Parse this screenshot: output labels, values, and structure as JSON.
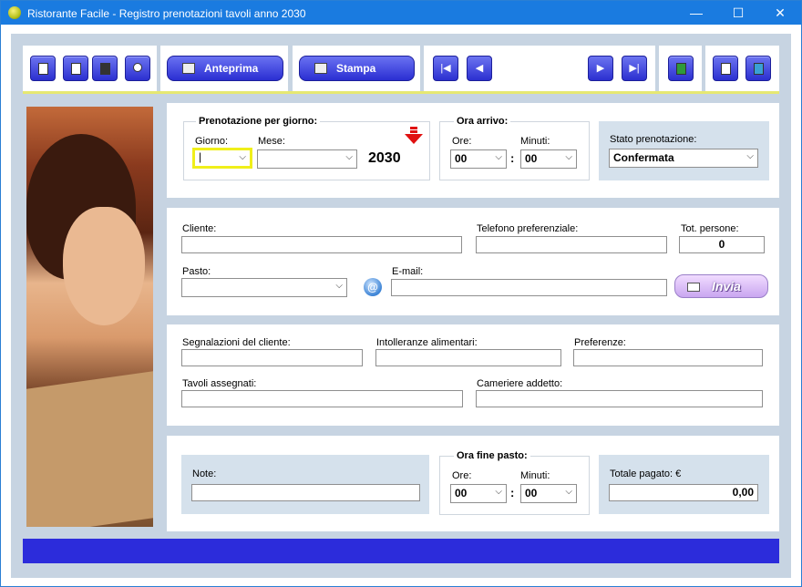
{
  "window": {
    "title": "Ristorante Facile - Registro prenotazioni tavoli anno 2030",
    "minimize": "—",
    "maximize": "☐",
    "close": "✕"
  },
  "toolbar": {
    "anteprima_label": "Anteprima",
    "stampa_label": "Stampa",
    "nav_first": "|◀",
    "nav_prev": "◀",
    "nav_next": "▶",
    "nav_last": "▶|"
  },
  "prenotazione": {
    "group_label": "Prenotazione per giorno:",
    "giorno_label": "Giorno:",
    "giorno_value": "|",
    "mese_label": "Mese:",
    "mese_value": "",
    "year": "2030"
  },
  "ora_arrivo": {
    "group_label": "Ora arrivo:",
    "ore_label": "Ore:",
    "ore_value": "00",
    "minuti_label": "Minuti:",
    "minuti_value": "00",
    "separator": ":"
  },
  "stato": {
    "label": "Stato prenotazione:",
    "value": "Confermata"
  },
  "cliente": {
    "cliente_label": "Cliente:",
    "cliente_value": "",
    "telefono_label": "Telefono preferenziale:",
    "telefono_value": "",
    "persone_label": "Tot. persone:",
    "persone_value": "0",
    "pasto_label": "Pasto:",
    "pasto_value": "",
    "email_label": "E-mail:",
    "email_value": "",
    "at_symbol": "@",
    "invia_label": "Invia"
  },
  "dettagli": {
    "segnalazioni_label": "Segnalazioni del cliente:",
    "intolleranze_label": "Intolleranze alimentari:",
    "preferenze_label": "Preferenze:",
    "tavoli_label": "Tavoli assegnati:",
    "cameriere_label": "Cameriere addetto:"
  },
  "fine": {
    "note_label": "Note:",
    "group_label": "Ora fine pasto:",
    "ore_label": "Ore:",
    "ore_value": "00",
    "minuti_label": "Minuti:",
    "minuti_value": "00",
    "separator": ":",
    "totale_label": "Totale pagato: €",
    "totale_value": "0,00"
  },
  "icons": [
    "new-icon",
    "copy-icon",
    "save-icon",
    "search-icon",
    "preview-icon",
    "print-icon",
    "excel-icon",
    "help-icon",
    "exit-icon",
    "email-at-icon",
    "envelope-icon",
    "down-arrow-icon"
  ],
  "colors": {
    "titlebar": "#1a7be0",
    "accent_button": "#2b2fd0",
    "status_bar": "#2c2cdb",
    "highlight": "#f0ef1a"
  }
}
